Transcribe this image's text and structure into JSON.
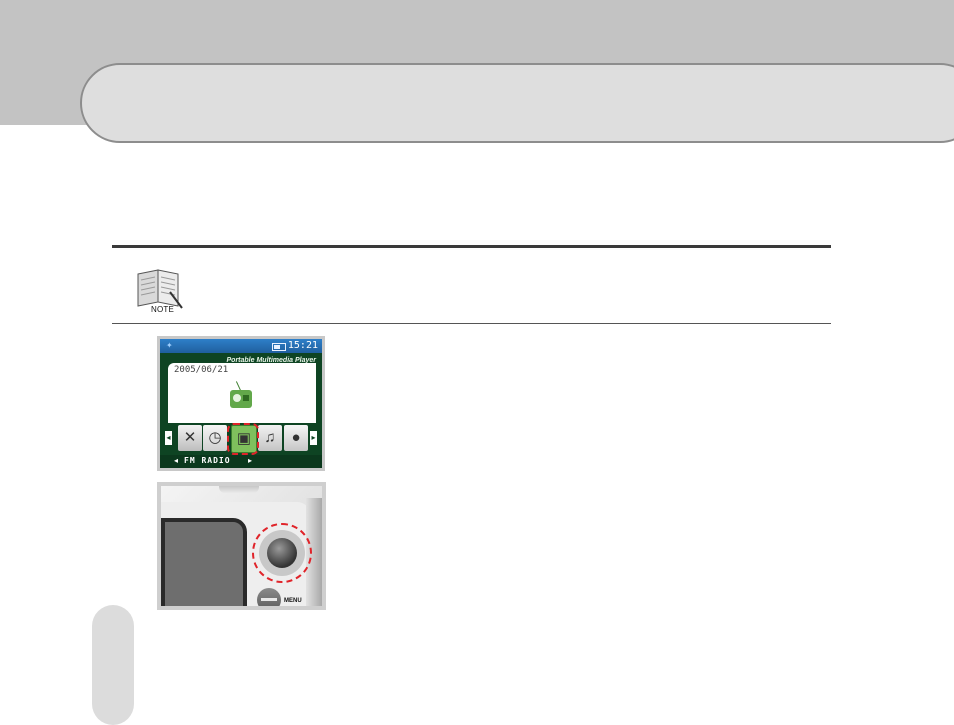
{
  "note": {
    "label": "NOTE"
  },
  "screen": {
    "status_time": "15:21",
    "brand": "Portable Multimedia Player",
    "date": "2005/06/21",
    "menu_caption": "FM RADIO",
    "caption_left_arrow": "◂",
    "caption_right_arrow": "▸",
    "nav_left": "◂",
    "nav_right": "▸",
    "icons": [
      "settings-icon",
      "clock-icon",
      "fm-radio-icon",
      "music-icon",
      "microphone-icon"
    ]
  },
  "device": {
    "menu_label": "MENU"
  },
  "colors": {
    "highlight": "#e0242a",
    "screen_green": "#0e4423",
    "status_blue": "#2e7fc9"
  }
}
